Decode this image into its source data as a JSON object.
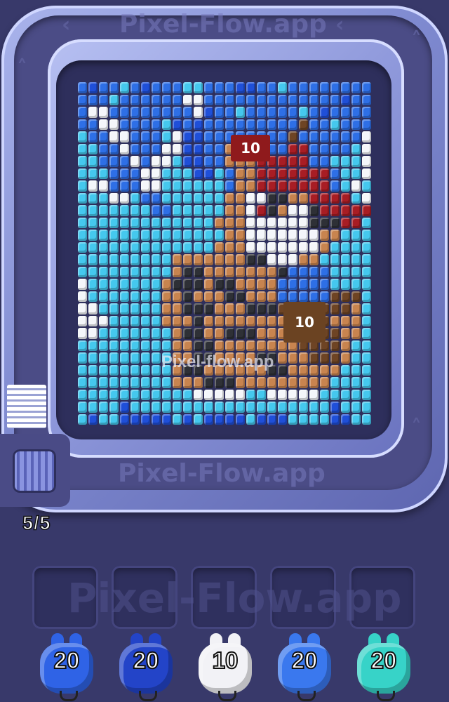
{
  "watermark": {
    "track_top": "Pixel-Flow.app",
    "track_bottom": "Pixel-Flow.app",
    "board": "Pixel-flow.app",
    "slots": "Pixel-Flow.app"
  },
  "board": {
    "badges": [
      {
        "value": "10",
        "color": "#8f1a1c"
      },
      {
        "value": "10",
        "color": "#6b4322"
      }
    ]
  },
  "conveyor": {
    "counter": "5/5"
  },
  "slots": [
    {
      "state": "empty"
    },
    {
      "state": "empty"
    },
    {
      "state": "empty"
    },
    {
      "state": "empty"
    },
    {
      "state": "empty"
    }
  ],
  "shooters": [
    {
      "value": "20",
      "color": "#2f63e6"
    },
    {
      "value": "20",
      "color": "#2344c8"
    },
    {
      "value": "10",
      "color": "#f2f2f6"
    },
    {
      "value": "20",
      "color": "#3a78ee"
    },
    {
      "value": "20",
      "color": "#37d3c8"
    }
  ],
  "palette": {
    "S": "#45c8ee",
    "B": "#1f4fd8",
    "b": "#2e6fe6",
    "D": "#163ab4",
    "W": "#f4f6fa",
    "R": "#a81d24",
    "r": "#c03030",
    "O": "#c8844f",
    "o": "#e3a66a",
    "K": "#2e3036",
    "k": "#4a4c52",
    "N": "#6e4424",
    "P": "#ef8fa6"
  },
  "pixel_grid": [
    "bBbbSbBbbbSSbbbBBbbSbbbbbbbb",
    "bbbSbbbbbbWWbbbbbbbbbbbbbBbb",
    "bWWbbbbbbbbWBbbSbbbbbSbBbbbb",
    "bbWWbbbbSBbBbbbbbbbbbNbbSbbb",
    "SbbWWbbbSWBBbbbbbbbbNbbbbbbW",
    "SSbbWbbbWWBBbbOoOobbRRbbbbSW",
    "SSbbbWbWWSBBbbOOORRRRRbbSSSW",
    "SSSbbbWWSSSBBSbOORRRRRRRbSSW",
    "SWWbbbWWSSSSSSbOORRRRRRRbSWS",
    "SSSWWSbbSSSSSSOOWWKKOORRRRSW",
    "SSSSSSSbbSSSSSOOWRKOWWKRRRRR",
    "SSSSSSSSSSSSSOOOWWWWWWKKKRRS",
    "SSSSSSSSSSSSSSOOWWWWWWWOOSSS",
    "SSSSSSSSSSSSSOOOWWWWWWWOSSSS",
    "SSSSSSSSSOOOOOOOKKWWWOOSSSSS",
    "SSSSSSSSSOKKOOOOOOOKbbbbSSSS",
    "WSSSSSSSOKKKOKKOOOObbbbbSSSS",
    "WSSSSSSSOOKOOOKKOOObbbbbNNNS",
    "WWSSSSSSOOKKKOOOKKKNNNNNNNOS",
    "WWWSSSSSOOOKOOOOOOOONNNNOOOS",
    "WWSSSSSSSOKKOOKKKOOOOOONNOOS",
    "SSSSSSSSSOOKKOOOOOOOONNNNOSS",
    "SSSSSSSSSOOKKOOOOKKOOONNNOSS",
    "SSSSSSSSSOKKOOOOOOKKOOOOOSSS",
    "SSSSSSSSSOOOKKKOOOOOOOOOSSSS",
    "SSSSSSSSSSSWWWWWSSWWWWWSSSSS",
    "SSSSBSSSSSSSSSSSSSSSSSSSBSSS",
    "SBSSBBBBBSBSBBBBSBBBSSSSBBSS"
  ]
}
